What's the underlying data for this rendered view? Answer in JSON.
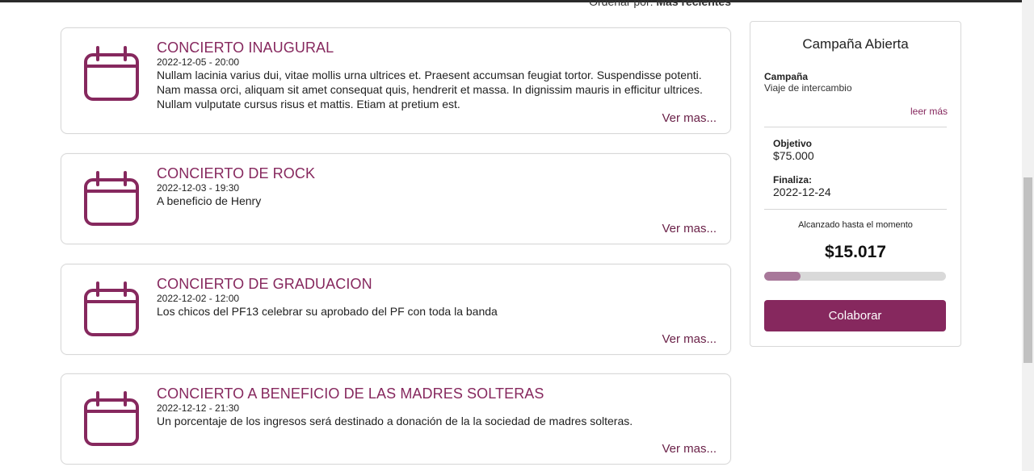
{
  "sort": {
    "label": "Ordenar por:",
    "value": "Más recientes"
  },
  "events": [
    {
      "title": "CONCIERTO INAUGURAL",
      "date": "2022-12-05 - 20:00",
      "description": "Nullam lacinia varius dui, vitae mollis urna ultrices et. Praesent accumsan feugiat tortor. Suspendisse potenti. Nam massa orci, aliquam sit amet consequat quis, hendrerit et massa. In dignissim mauris in efficitur ultrices. Nullam vulputate cursus risus et mattis. Etiam at pretium est.",
      "more": "Ver mas..."
    },
    {
      "title": "CONCIERTO DE ROCK",
      "date": "2022-12-03 - 19:30",
      "description": "A beneficio de Henry",
      "more": "Ver mas..."
    },
    {
      "title": "CONCIERTO DE GRADUACION",
      "date": "2022-12-02 - 12:00",
      "description": "Los chicos del PF13 celebrar su aprobado del PF con toda la banda",
      "more": "Ver mas..."
    },
    {
      "title": "CONCIERTO A BENEFICIO DE LAS MADRES SOLTERAS",
      "date": "2022-12-12 - 21:30",
      "description": "Un porcentaje de los ingresos será destinado a donación de la la sociedad de madres solteras.",
      "more": "Ver mas..."
    }
  ],
  "campaign": {
    "title": "Campaña Abierta",
    "campaign_label": "Campaña",
    "campaign_name": "Viaje de intercambio",
    "read_more": "leer más",
    "goal_label": "Objetivo",
    "goal_value": "$75.000",
    "ends_label": "Finaliza:",
    "ends_value": "2022-12-24",
    "reached_label": "Alcanzado hasta el momento",
    "reached_value": "$15.017",
    "progress_fraction": 0.2,
    "button_label": "Colaborar"
  },
  "colors": {
    "accent": "#86285e",
    "progress_fill": "#a8789a",
    "progress_track": "#d9d9d9"
  },
  "icons": {
    "event": "calendar-icon"
  }
}
